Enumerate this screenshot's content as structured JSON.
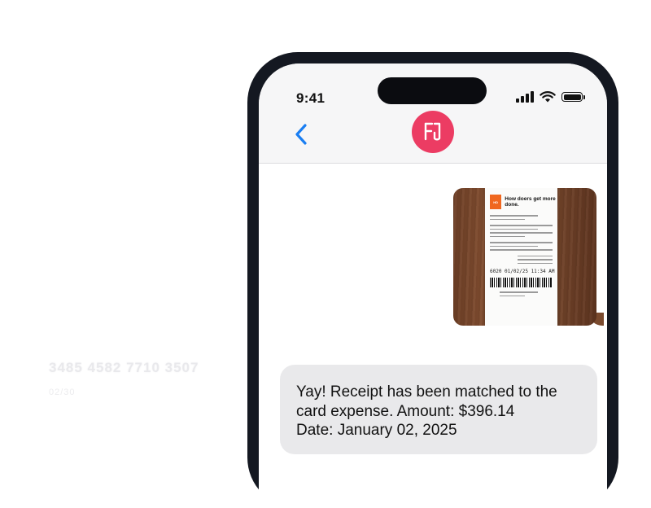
{
  "background_card": {
    "number": "3485 4582 7710 3507",
    "expiry": "02/30"
  },
  "status_bar": {
    "time": "9:41",
    "signal_icon": "cellular-signal-icon",
    "wifi_icon": "wifi-icon",
    "battery_icon": "battery-icon"
  },
  "header": {
    "back_icon": "chevron-left-icon",
    "avatar_icon": "app-logo-icon",
    "avatar_color": "#ec3c63",
    "accent_color": "#1a7ef2"
  },
  "thread": {
    "attachment": {
      "type": "receipt-photo",
      "tagline": "How doers get more done.",
      "date_time": "6020 01/02/25 11:34 AM"
    },
    "incoming_message": "Yay! Receipt has been matched to the\ncard expense. Amount: $396.14\nDate: January 02, 2025"
  }
}
